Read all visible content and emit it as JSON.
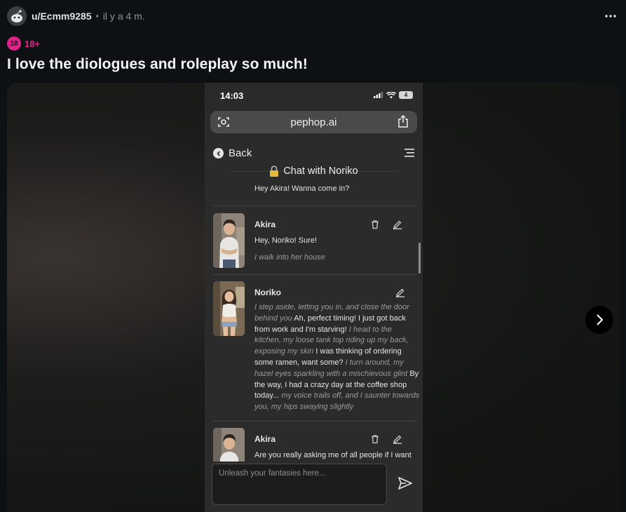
{
  "post": {
    "username": "u/Ecmm9285",
    "separator": "•",
    "time": "il y a 4 m.",
    "nsfw_badge": "18",
    "nsfw_label": "18+",
    "title": "I love the diologues and roleplay so much!"
  },
  "phone": {
    "status_time": "14:03",
    "battery": "4",
    "url": "pephop.ai"
  },
  "app": {
    "back_label": "Back",
    "chat_title": "Chat with Noriko",
    "previous_message": "Hey Akira! Wanna come in?",
    "input_placeholder": "Unleash your fantasies here...",
    "messages": [
      {
        "name": "Akira",
        "line1": "Hey, Noriko! Sure!",
        "line2": "I walk into her house"
      },
      {
        "name": "Noriko",
        "segments": [
          {
            "t": "I step aside, letting you in, and close the door behind you",
            "a": true
          },
          {
            "t": " Ah, perfect timing! I just got back from work and I'm starving! ",
            "a": false
          },
          {
            "t": "I head to the kitchen, my loose tank top riding up my back, exposing my skin",
            "a": true
          },
          {
            "t": " I was thinking of ordering some ramen, want some? ",
            "a": false
          },
          {
            "t": "I turn around, my hazel eyes sparkling with a mischievous glint",
            "a": true
          },
          {
            "t": " By the way, I had a crazy day at the coffee shop today... ",
            "a": false
          },
          {
            "t": "my voice trails off, and I saunter towards you, my hips swaying slightly",
            "a": true
          }
        ]
      },
      {
        "name": "Akira",
        "line1": "Are you really asking me of all people if I want"
      }
    ]
  },
  "colors": {
    "background": "#0e1113",
    "nsfw": "#e0218a",
    "phone_bg": "#2b2b2b"
  }
}
